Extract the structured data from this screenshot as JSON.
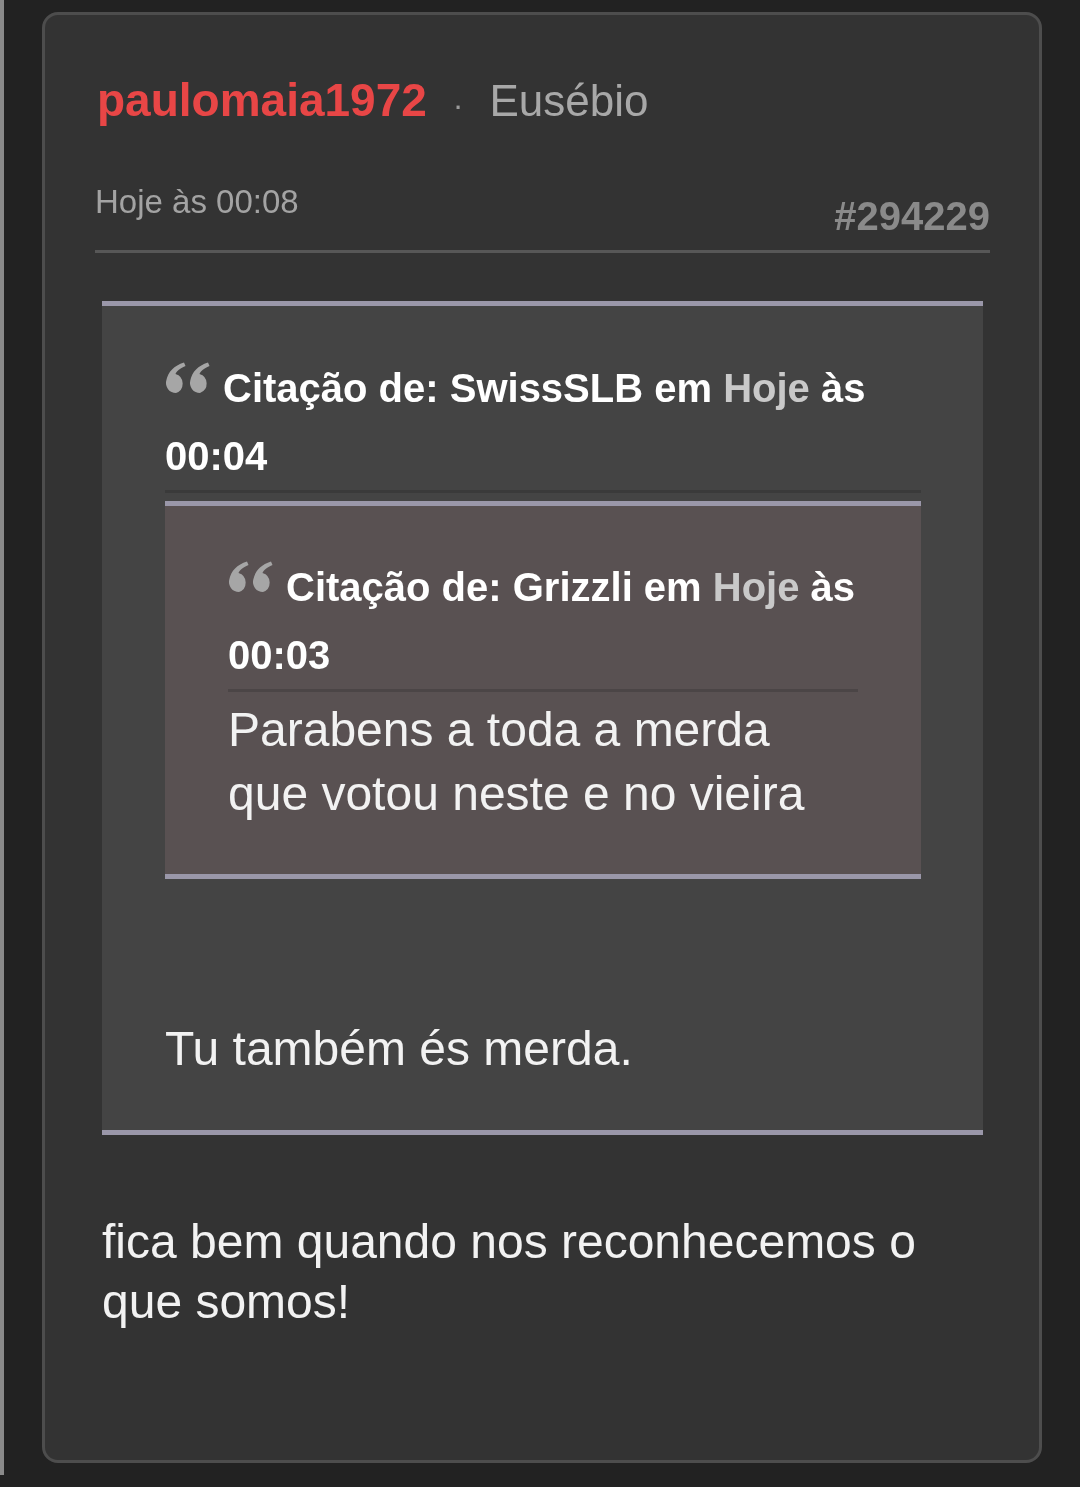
{
  "post": {
    "author": "paulomaia1972",
    "separator": "·",
    "team": "Eusébio",
    "time": "Hoje às 00:08",
    "number": "#294229",
    "quote": {
      "header": {
        "text_before": "Citação de: SwissSLB em",
        "link": "Hoje",
        "text_after": "às 00:04"
      },
      "nested_quote": {
        "header": {
          "text_before": "Citação de: Grizzli em",
          "link": "Hoje",
          "text_after": "às 00:03"
        },
        "text": "Parabens a toda a merda que votou neste e no vieira"
      },
      "text": "Tu também és merda."
    },
    "body": "fica bem quando nos reconhecemos o que somos!"
  }
}
